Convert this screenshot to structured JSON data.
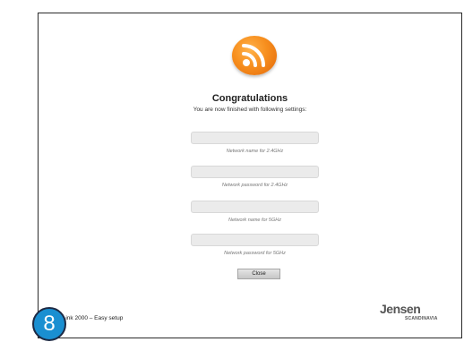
{
  "logo": {
    "icon": "wifi-signal-icon",
    "color": "#f78f1e"
  },
  "header": {
    "title": "Congratulations",
    "subtitle": "You are now finished with following settings:"
  },
  "fields": [
    {
      "caption": "Network name for 2.4GHz",
      "value": ""
    },
    {
      "caption": "Network password for 2.4GHz",
      "value": ""
    },
    {
      "caption": "Network name for 5GHz",
      "value": ""
    },
    {
      "caption": "Network password for 5GHz",
      "value": ""
    }
  ],
  "buttons": {
    "close_label": "Close"
  },
  "footer": {
    "product": "Air:Link 2000 – Easy setup",
    "brand": "Jensen",
    "brand_sub": "SCANDINAVIA"
  },
  "step": {
    "number": "8",
    "color": "#1a8fd1"
  }
}
